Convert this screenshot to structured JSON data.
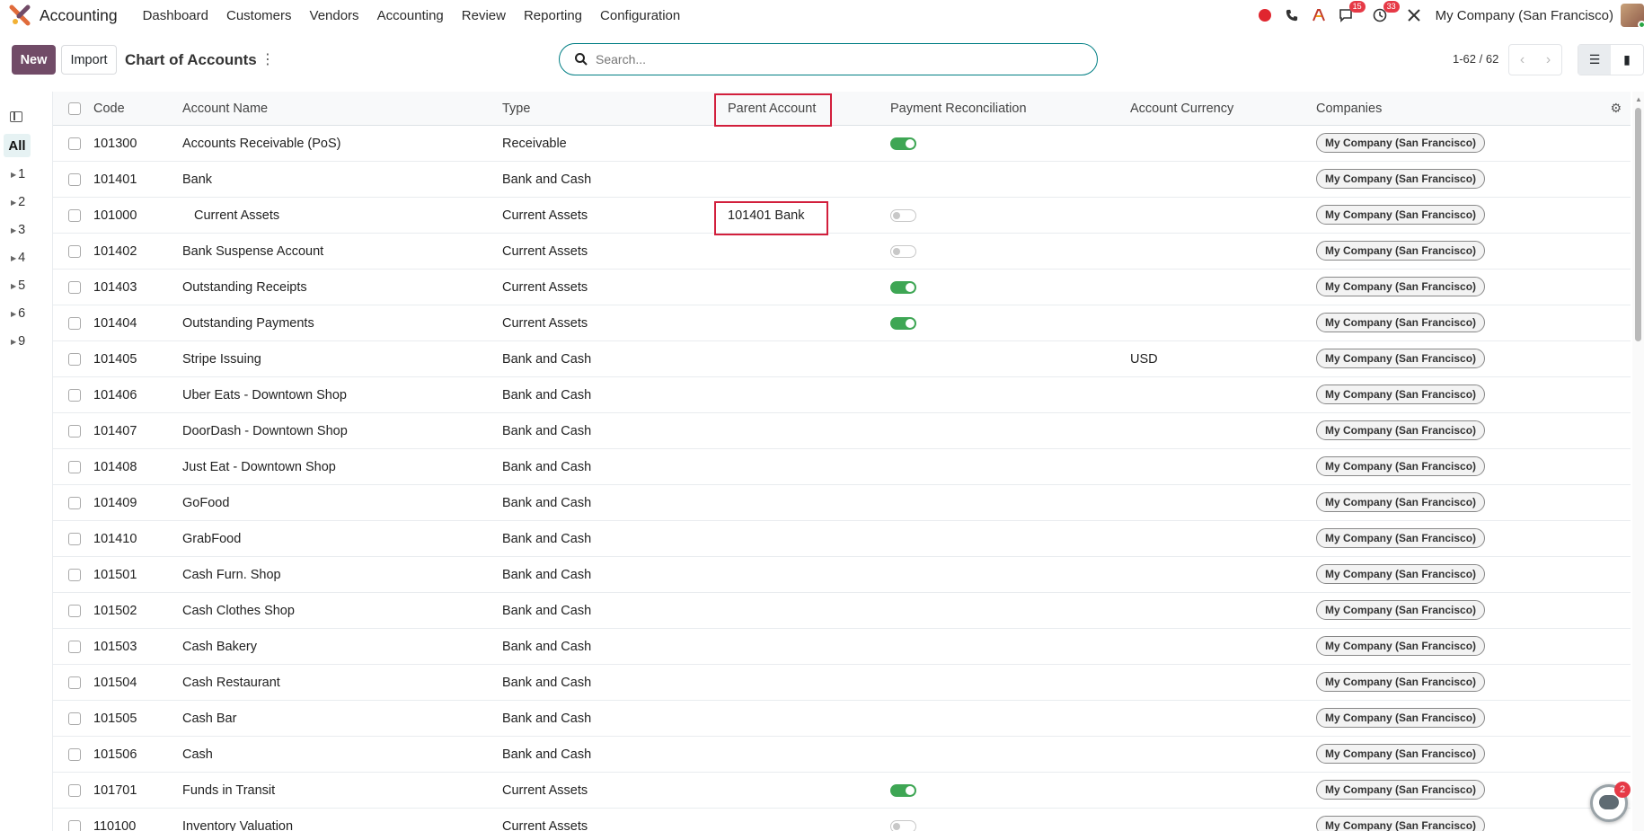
{
  "topbar": {
    "app_name": "Accounting",
    "nav": [
      "Dashboard",
      "Customers",
      "Vendors",
      "Accounting",
      "Review",
      "Reporting",
      "Configuration"
    ],
    "messages_badge": "15",
    "activities_badge": "33",
    "company": "My Company (San Francisco)"
  },
  "control": {
    "new_label": "New",
    "import_label": "Import",
    "title": "Chart of Accounts",
    "search_placeholder": "Search...",
    "pager": "1-62 / 62"
  },
  "sidepanel": {
    "all_label": "All",
    "groups": [
      "1",
      "2",
      "3",
      "4",
      "5",
      "6",
      "9"
    ]
  },
  "table": {
    "headers": {
      "code": "Code",
      "name": "Account Name",
      "type": "Type",
      "parent": "Parent Account",
      "reconcile": "Payment Reconciliation",
      "currency": "Account Currency",
      "companies": "Companies"
    },
    "rows": [
      {
        "code": "101300",
        "name": "Accounts Receivable (PoS)",
        "type": "Receivable",
        "parent": "",
        "reconcile": "on",
        "currency": "",
        "company": "My Company (San Francisco)"
      },
      {
        "code": "101401",
        "name": "Bank",
        "type": "Bank and Cash",
        "parent": "",
        "reconcile": "none",
        "currency": "",
        "company": "My Company (San Francisco)"
      },
      {
        "code": "101000",
        "name": "Current Assets",
        "type": "Current Assets",
        "parent": "101401 Bank",
        "reconcile": "off",
        "currency": "",
        "company": "My Company (San Francisco)",
        "indent": true
      },
      {
        "code": "101402",
        "name": "Bank Suspense Account",
        "type": "Current Assets",
        "parent": "",
        "reconcile": "off",
        "currency": "",
        "company": "My Company (San Francisco)"
      },
      {
        "code": "101403",
        "name": "Outstanding Receipts",
        "type": "Current Assets",
        "parent": "",
        "reconcile": "on",
        "currency": "",
        "company": "My Company (San Francisco)"
      },
      {
        "code": "101404",
        "name": "Outstanding Payments",
        "type": "Current Assets",
        "parent": "",
        "reconcile": "on",
        "currency": "",
        "company": "My Company (San Francisco)"
      },
      {
        "code": "101405",
        "name": "Stripe Issuing",
        "type": "Bank and Cash",
        "parent": "",
        "reconcile": "none",
        "currency": "USD",
        "company": "My Company (San Francisco)"
      },
      {
        "code": "101406",
        "name": "Uber Eats - Downtown Shop",
        "type": "Bank and Cash",
        "parent": "",
        "reconcile": "none",
        "currency": "",
        "company": "My Company (San Francisco)"
      },
      {
        "code": "101407",
        "name": "DoorDash - Downtown Shop",
        "type": "Bank and Cash",
        "parent": "",
        "reconcile": "none",
        "currency": "",
        "company": "My Company (San Francisco)"
      },
      {
        "code": "101408",
        "name": "Just Eat - Downtown Shop",
        "type": "Bank and Cash",
        "parent": "",
        "reconcile": "none",
        "currency": "",
        "company": "My Company (San Francisco)"
      },
      {
        "code": "101409",
        "name": "GoFood",
        "type": "Bank and Cash",
        "parent": "",
        "reconcile": "none",
        "currency": "",
        "company": "My Company (San Francisco)"
      },
      {
        "code": "101410",
        "name": "GrabFood",
        "type": "Bank and Cash",
        "parent": "",
        "reconcile": "none",
        "currency": "",
        "company": "My Company (San Francisco)"
      },
      {
        "code": "101501",
        "name": "Cash Furn. Shop",
        "type": "Bank and Cash",
        "parent": "",
        "reconcile": "none",
        "currency": "",
        "company": "My Company (San Francisco)"
      },
      {
        "code": "101502",
        "name": "Cash Clothes Shop",
        "type": "Bank and Cash",
        "parent": "",
        "reconcile": "none",
        "currency": "",
        "company": "My Company (San Francisco)"
      },
      {
        "code": "101503",
        "name": "Cash Bakery",
        "type": "Bank and Cash",
        "parent": "",
        "reconcile": "none",
        "currency": "",
        "company": "My Company (San Francisco)"
      },
      {
        "code": "101504",
        "name": "Cash Restaurant",
        "type": "Bank and Cash",
        "parent": "",
        "reconcile": "none",
        "currency": "",
        "company": "My Company (San Francisco)"
      },
      {
        "code": "101505",
        "name": "Cash Bar",
        "type": "Bank and Cash",
        "parent": "",
        "reconcile": "none",
        "currency": "",
        "company": "My Company (San Francisco)"
      },
      {
        "code": "101506",
        "name": "Cash",
        "type": "Bank and Cash",
        "parent": "",
        "reconcile": "none",
        "currency": "",
        "company": "My Company (San Francisco)"
      },
      {
        "code": "101701",
        "name": "Funds in Transit",
        "type": "Current Assets",
        "parent": "",
        "reconcile": "on",
        "currency": "",
        "company": "My Company (San Francisco)"
      },
      {
        "code": "110100",
        "name": "Inventory Valuation",
        "type": "Current Assets",
        "parent": "",
        "reconcile": "off",
        "currency": "",
        "company": "My Company (San Francisco)"
      }
    ]
  },
  "chat_badge": "2",
  "colors": {
    "brand": "#714b67",
    "accent": "#017e84",
    "toggle_on": "#3ea654",
    "highlight": "#d21f3c"
  }
}
